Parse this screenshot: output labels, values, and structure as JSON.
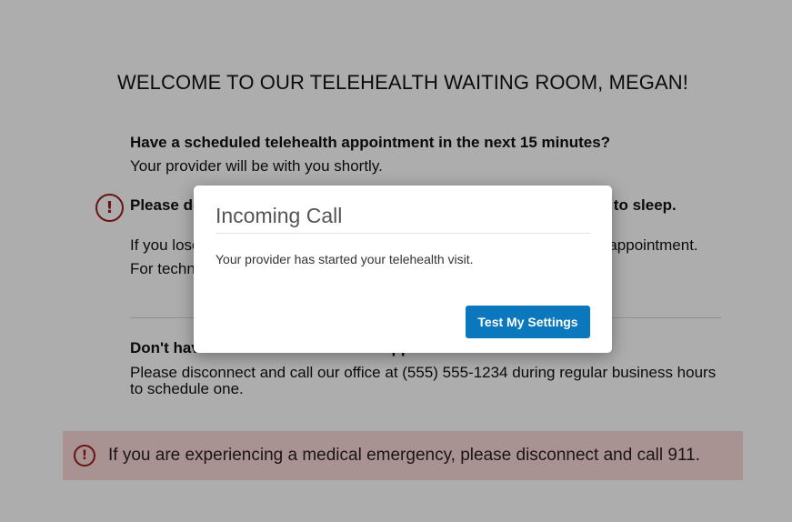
{
  "page": {
    "welcome_title": "WELCOME TO OUR TELEHEALTH WAITING ROOM, MEGAN!",
    "scheduled": {
      "heading": "Have a scheduled telehealth appointment in the next 15 minutes?",
      "text": "Your provider will be with you shortly."
    },
    "warning": {
      "heading": "Please do not close this browser window or let your computer go to sleep.",
      "text1": "If you lose connection, please try to reconnect before the start of your appointment.",
      "text2": "For technical support, please call our office at (555) 555-1234."
    },
    "no_appointment": {
      "heading": "Don't have a scheduled telehealth appointment?",
      "text": "Please disconnect and call our office at (555) 555-1234 during regular business hours to schedule one."
    },
    "emergency": {
      "text": "If you are experiencing a medical emergency, please disconnect and call 911."
    }
  },
  "modal": {
    "title": "Incoming Call",
    "body": "Your provider has started your telehealth visit.",
    "button_label": "Test My Settings"
  },
  "icons": {
    "alert": "!"
  },
  "colors": {
    "alert_red": "#9b1c1c",
    "emergency_bg": "#f8d7d8",
    "button_blue": "#0b77bd"
  }
}
